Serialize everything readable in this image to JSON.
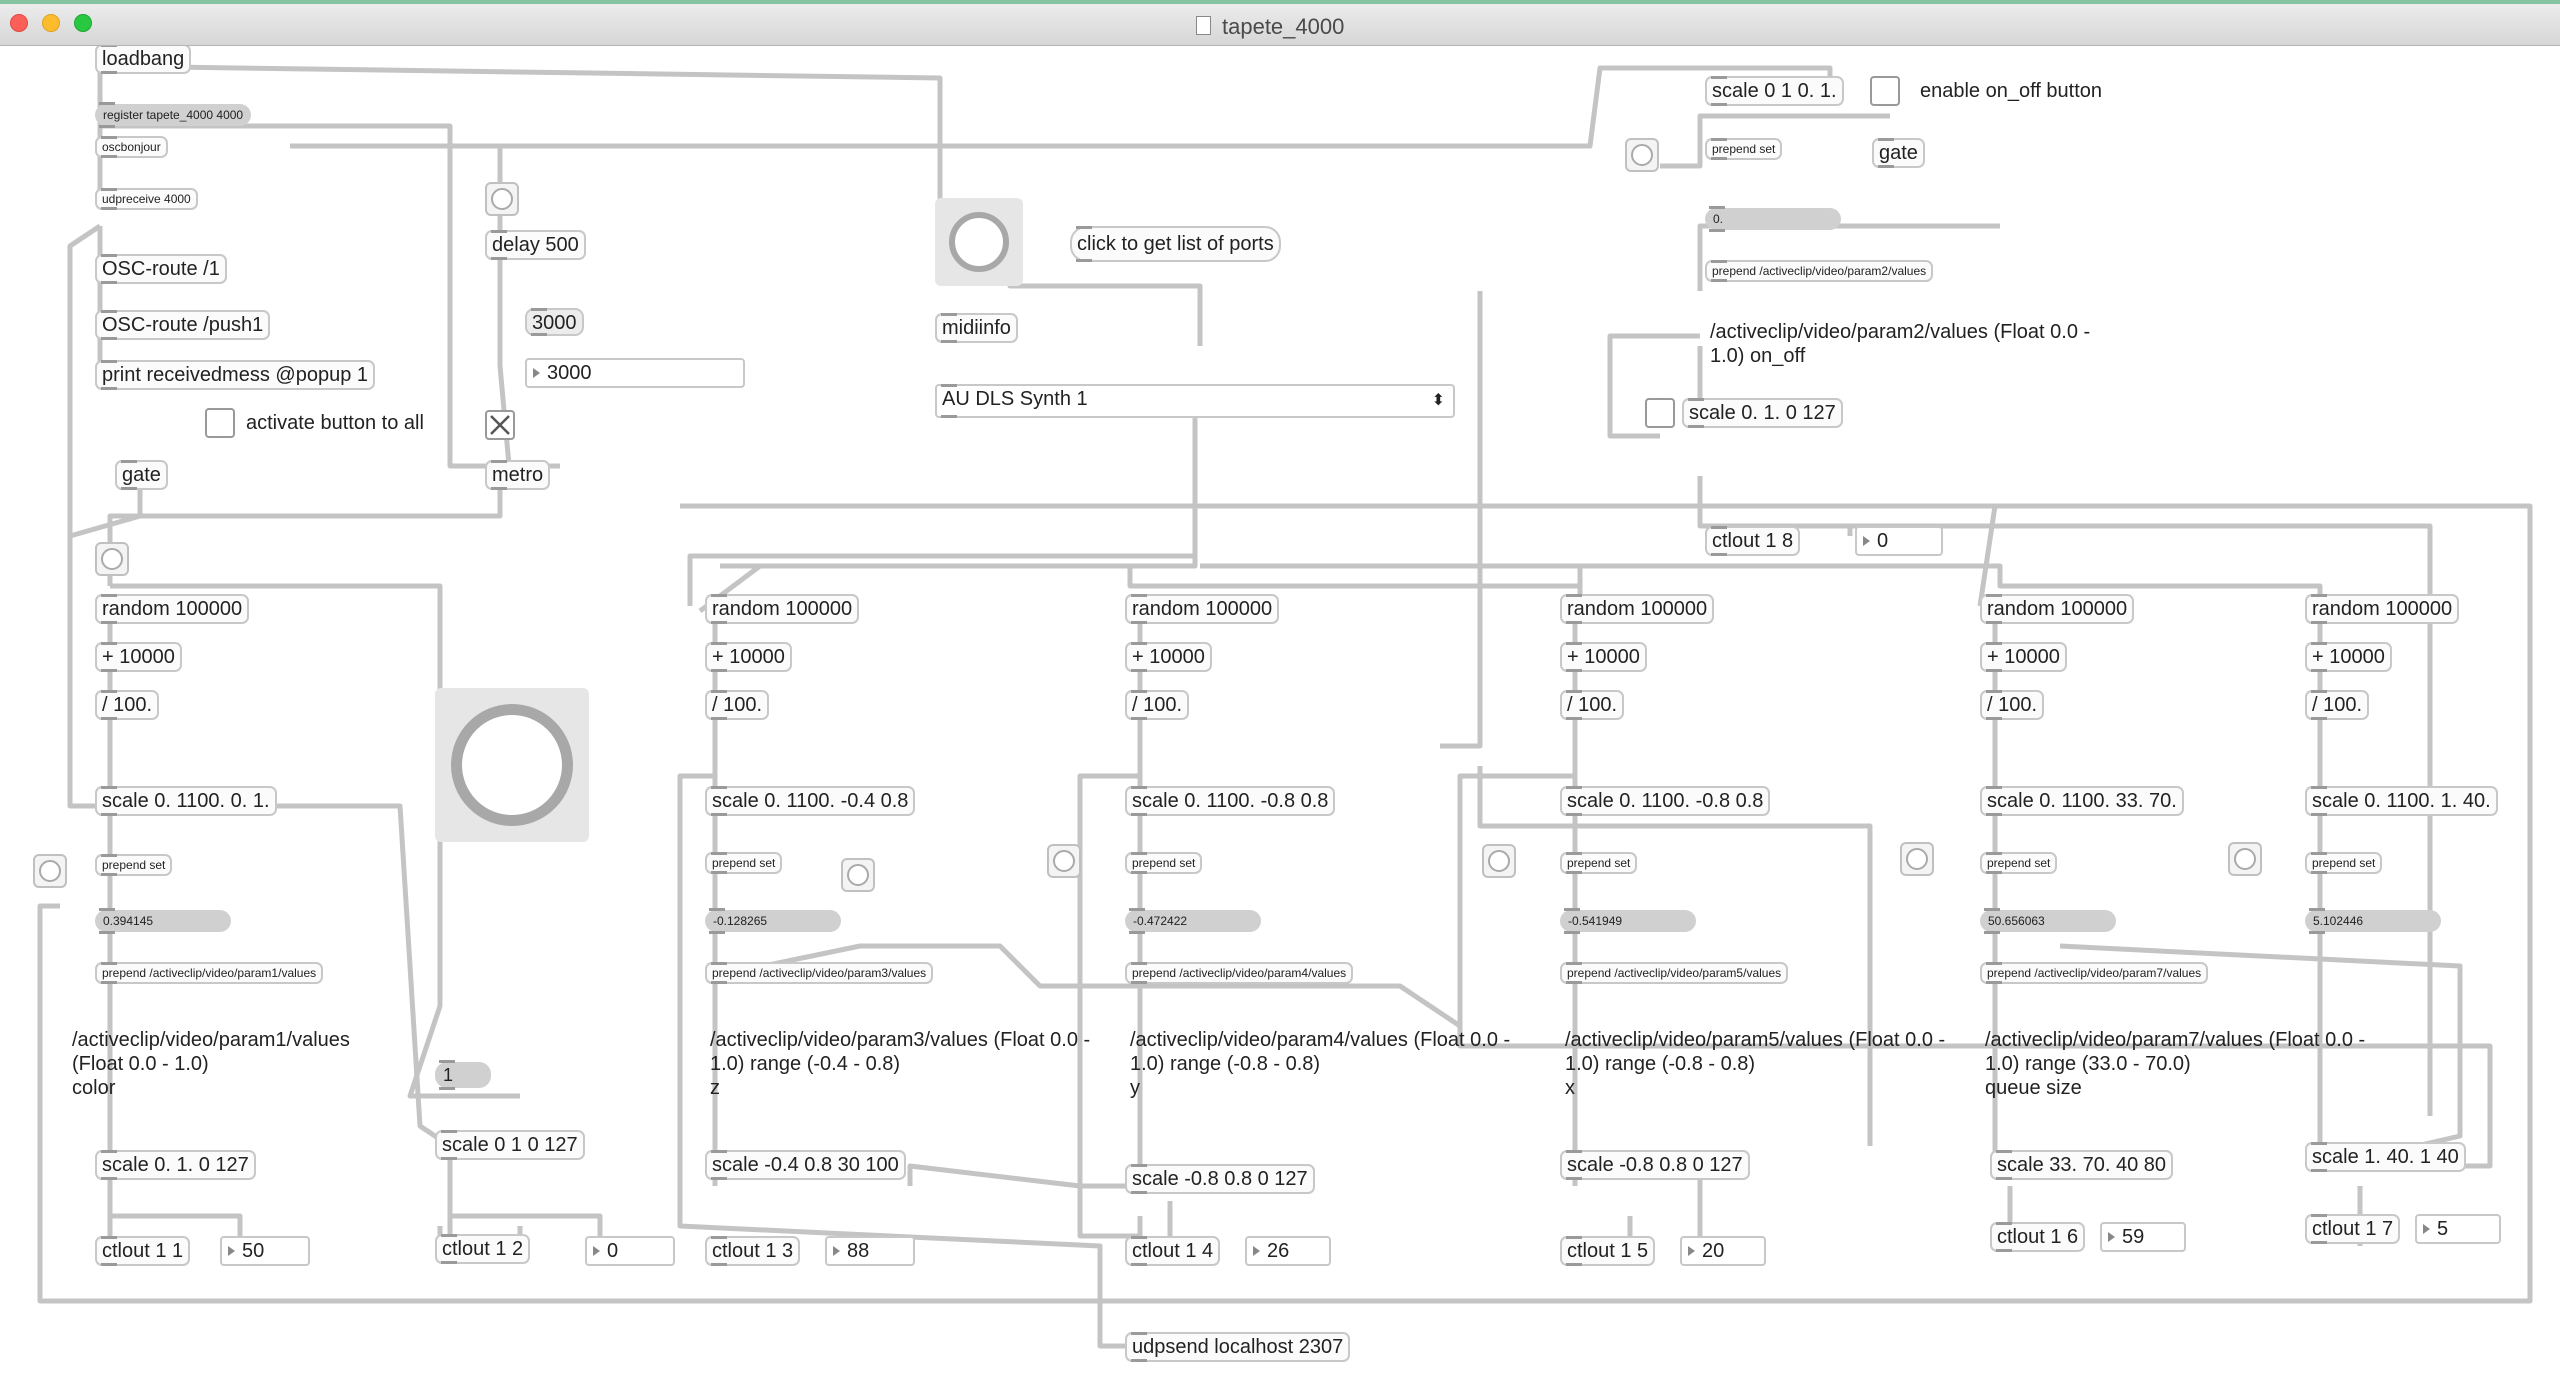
{
  "window": {
    "title": "tapete_4000"
  },
  "objects": {
    "loadbang": "loadbang",
    "register": "register tapete_4000 4000",
    "oscbonjour": "oscbonjour",
    "udpreceive": "udpreceive 4000",
    "oscroute1": "OSC-route /1",
    "oscroute_push1": "OSC-route /push1",
    "print": "print receivedmess @popup 1",
    "delay": "delay 500",
    "metro": "metro",
    "gate_left": "gate",
    "midiinfo": "midiinfo",
    "scale_top": "scale 0 1 0. 1.",
    "gate_top": "gate",
    "prepend_set_top": "prepend set",
    "prepend_param2": "prepend /activeclip/video/param2/values",
    "scale_param2": "scale 0. 1. 0 127",
    "ctlout_18": "ctlout 1 8",
    "random": "random 100000",
    "plus": "+ 10000",
    "div": "/ 100.",
    "prepend_set": "prepend set",
    "scale_col1": "scale 0. 1100. 0. 1.",
    "scale_col3": "scale 0. 1100. -0.4 0.8",
    "scale_col4": "scale 0. 1100. -0.8 0.8",
    "scale_col5": "scale 0. 1100. -0.8 0.8",
    "scale_col6": "scale 0. 1100. 33. 70.",
    "scale_col7": "scale 0. 1100. 1. 40.",
    "prepend_p1": "prepend /activeclip/video/param1/values",
    "prepend_p3": "prepend /activeclip/video/param3/values",
    "prepend_p4": "prepend /activeclip/video/param4/values",
    "prepend_p5": "prepend /activeclip/video/param5/values",
    "prepend_p7": "prepend /activeclip/video/param7/values",
    "scale_out1": "scale 0. 1. 0 127",
    "scale_out2": "scale 0 1 0 127",
    "scale_out3": "scale -0.4 0.8 30 100",
    "scale_out4": "scale -0.8 0.8 0 127",
    "scale_out5": "scale -0.8 0.8 0 127",
    "scale_out6": "scale 33. 70. 40 80",
    "scale_out7": "scale 1. 40. 1 40",
    "ctlout_11": "ctlout 1 1",
    "ctlout_12": "ctlout 1 2",
    "ctlout_13": "ctlout 1 3",
    "ctlout_14": "ctlout 1 4",
    "ctlout_15": "ctlout 1 5",
    "ctlout_16": "ctlout 1 6",
    "ctlout_17": "ctlout 1 7",
    "udpsend": "udpsend localhost 2307"
  },
  "messages": {
    "m3000": "3000",
    "top_value": "0.",
    "val1": "0.394145",
    "val3": "-0.128265",
    "val4": "-0.472422",
    "val5": "-0.541949",
    "val6": "50.656063",
    "val7": "5.102446",
    "one": "1"
  },
  "numbers": {
    "n3000": "3000",
    "top0": "0",
    "out1": "50",
    "out2": "0",
    "out3": "88",
    "out4": "26",
    "out5": "20",
    "out6": "59",
    "out7": "5"
  },
  "labels": {
    "enable": "enable on_off button",
    "activate": "activate button to all",
    "click_ports": "click to get list of ports"
  },
  "menu": {
    "selected": "AU DLS Synth 1"
  },
  "comments": {
    "param2": "/activeclip/video/param2/values (Float 0.0 -\n1.0) on_off",
    "param1": "/activeclip/video/param1/values\n(Float 0.0 - 1.0)\ncolor",
    "param3": "/activeclip/video/param3/values (Float 0.0 -\n1.0) range (-0.4 - 0.8)\nz",
    "param4": "/activeclip/video/param4/values (Float 0.0 -\n1.0) range (-0.8 - 0.8)\ny",
    "param5": "/activeclip/video/param5/values (Float 0.0 -\n1.0) range (-0.8 - 0.8)\nx",
    "param7": "/activeclip/video/param7/values (Float 0.0 -\n1.0) range (33.0 - 70.0)\nqueue size"
  },
  "toggles": {
    "activate_checked": false,
    "metro_checked": true,
    "enable_checked": false,
    "scale_param2_checked": false
  },
  "colors": {
    "cord": "#c4c4c4",
    "box_border": "#c8c8c8",
    "message_fill": "#ececec"
  }
}
